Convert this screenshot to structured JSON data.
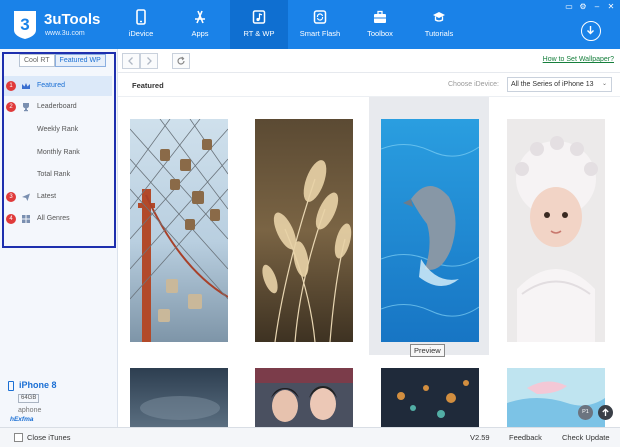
{
  "app": {
    "name": "3uTools",
    "url": "www.3u.com",
    "logo_numeral": "3"
  },
  "nav": [
    {
      "label": "iDevice",
      "icon": "phone-icon"
    },
    {
      "label": "Apps",
      "icon": "app-store-icon"
    },
    {
      "label": "RT & WP",
      "icon": "music-wallpaper-icon",
      "active": true
    },
    {
      "label": "Smart Flash",
      "icon": "flash-icon"
    },
    {
      "label": "Toolbox",
      "icon": "toolbox-icon"
    },
    {
      "label": "Tutorials",
      "icon": "graduation-cap-icon"
    }
  ],
  "sidebar": {
    "tabs": [
      "Cool RT",
      "Featured WP"
    ],
    "active_tab": 1,
    "items": [
      {
        "badge": "1",
        "label": "Featured",
        "icon": "crown-icon",
        "active": true
      },
      {
        "badge": "2",
        "label": "Leaderboard",
        "icon": "trophy-icon"
      },
      {
        "label": "Weekly Rank"
      },
      {
        "label": "Monthly Rank"
      },
      {
        "label": "Total Rank"
      },
      {
        "badge": "3",
        "label": "Latest",
        "icon": "paper-plane-icon"
      },
      {
        "badge": "4",
        "label": "All Genres",
        "icon": "grid-icon"
      }
    ]
  },
  "device": {
    "name": "iPhone 8",
    "capacity": "64GB",
    "sub": "aphone",
    "brand": "hExfma"
  },
  "toolbar": {
    "help_link": "How to Set Wallpaper?"
  },
  "content": {
    "breadcrumb": "Featured",
    "choose_label": "Choose iDevice:",
    "choose_value": "All the Series of iPhone 13",
    "tooltip": "Preview",
    "page_indicator": "P1"
  },
  "wallpapers": [
    {
      "name": "love-locks-bridge-wallpaper"
    },
    {
      "name": "reeds-wallpaper"
    },
    {
      "name": "dolphin-wallpaper"
    },
    {
      "name": "child-portrait-wallpaper"
    },
    {
      "name": "misty-wallpaper"
    },
    {
      "name": "couple-wallpaper"
    },
    {
      "name": "night-city-wallpaper"
    },
    {
      "name": "whale-wallpaper"
    }
  ],
  "status": {
    "close_itunes": "Close iTunes",
    "version": "V2.59",
    "feedback": "Feedback",
    "check_update": "Check Update"
  },
  "colors": {
    "brand": "#1a82e8",
    "badge": "#e03a3a",
    "link": "#167f3c",
    "highlight_frame": "#1e2fae"
  }
}
